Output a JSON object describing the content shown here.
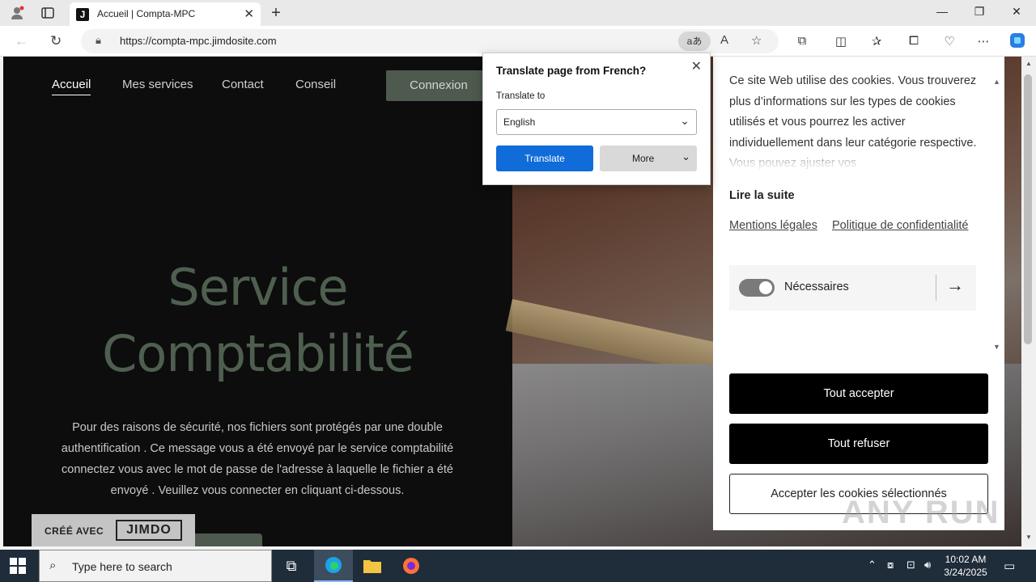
{
  "browser": {
    "tab_title": "Accueil | Compta-MPC",
    "tab_favicon_letter": "J",
    "url": "https://compta-mpc.jimdosite.com",
    "translate_pill": "aあ"
  },
  "site": {
    "nav": [
      "Accueil",
      "Mes services",
      "Contact",
      "Conseil"
    ],
    "login_label": "Connexion",
    "hero_title_line1": "Service",
    "hero_title_line2": "Comptabilité",
    "hero_text": "Pour des raisons de sécurité, nos fichiers sont protégés par une double authentification . Ce message vous a été envoyé par le service comptabilité connectez vous avec le mot de passe de l'adresse à laquelle le fichier a été envoyé . Veuillez vous connecter en cliquant ci-dessous.",
    "badge_made_with": "CRÉÉ AVEC",
    "badge_logo": "JIMDO"
  },
  "cookie": {
    "text": "Ce site Web utilise des cookies. Vous trouverez plus d’informations sur les types de cookies utilisés et vous pourrez les activer individuellement dans leur catégorie respective. Vous pouvez ajuster vos",
    "read_more": "Lire la suite",
    "link_legal": "Mentions légales",
    "link_privacy": "Politique de confidentialité",
    "necessary_label": "Nécessaires",
    "accept_all": "Tout accepter",
    "refuse_all": "Tout refuser",
    "accept_selected": "Accepter les cookies sélectionnés"
  },
  "translate_popup": {
    "title": "Translate page from French?",
    "translate_to_label": "Translate to",
    "selected_language": "English",
    "translate_button": "Translate",
    "more_button": "More"
  },
  "taskbar": {
    "search_placeholder": "Type here to search",
    "time": "10:02 AM",
    "date": "3/24/2025"
  },
  "watermark": "ANY RUN"
}
